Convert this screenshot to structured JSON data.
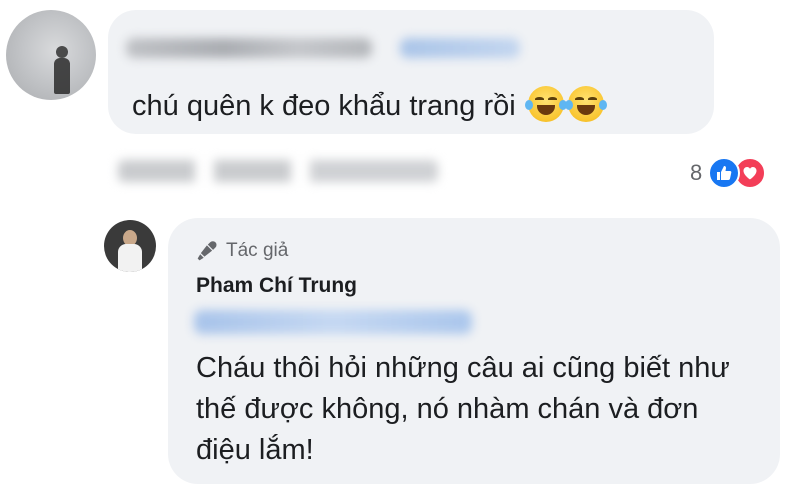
{
  "comment": {
    "text": "chú quên k đeo khẩu trang rồi",
    "emojis": [
      "joy-emoji",
      "joy-emoji"
    ],
    "reactions": {
      "count": "8",
      "types": [
        "like",
        "love"
      ],
      "colors": {
        "like": "#1877f2",
        "love": "#f33e58"
      }
    }
  },
  "reply": {
    "author_badge_icon": "microphone-icon",
    "author_badge": "Tác giả",
    "author_name": "Pham Chí Trung",
    "text": "Cháu thôi hỏi những câu ai cũng biết như thế được không, nó nhàm chán và đơn điệu lắm!"
  },
  "theme": {
    "bubble_bg": "#f0f2f5",
    "text_color": "#1c1e21",
    "secondary_text": "#65676b"
  }
}
